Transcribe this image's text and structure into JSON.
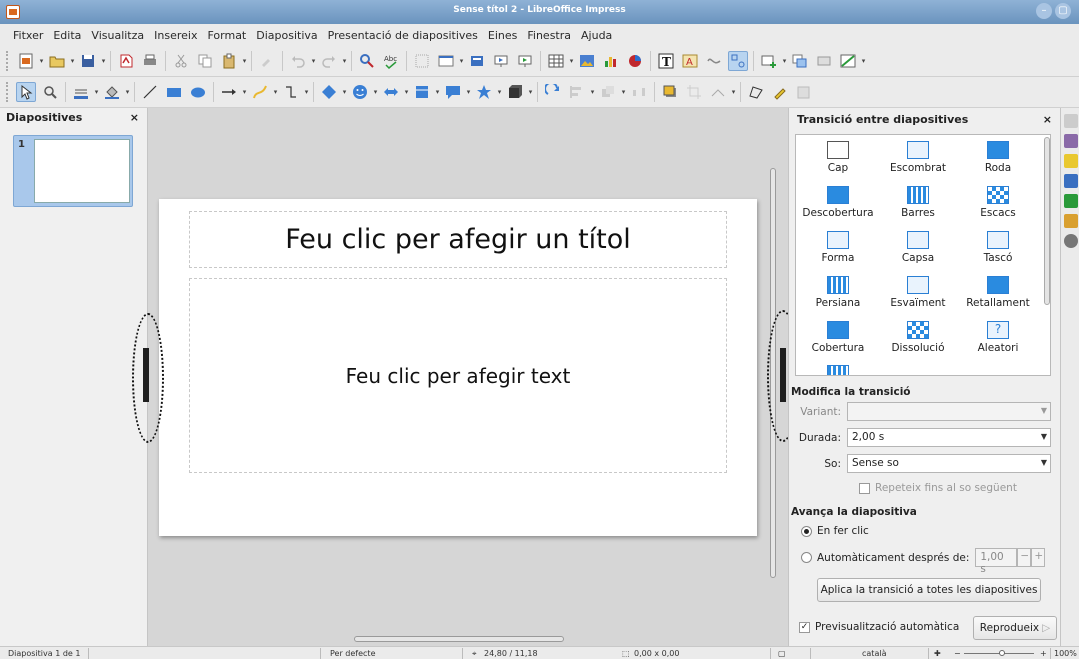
{
  "window": {
    "title": "Sense títol 2 - LibreOffice Impress"
  },
  "menu": [
    "Fitxer",
    "Edita",
    "Visualitza",
    "Insereix",
    "Format",
    "Diapositiva",
    "Presentació de diapositives",
    "Eines",
    "Finestra",
    "Ajuda"
  ],
  "slides_pane": {
    "title": "Diapositives",
    "close": "×",
    "slide_number": "1"
  },
  "slide": {
    "title_placeholder": "Feu clic per afegir un títol",
    "body_placeholder": "Feu clic per afegir text"
  },
  "transition_panel": {
    "title": "Transició entre diapositives",
    "close": "×",
    "transitions": [
      "Cap",
      "Escombrat",
      "Roda",
      "Descobertura",
      "Barres",
      "Escacs",
      "Forma",
      "Capsa",
      "Tascó",
      "Persiana",
      "Esvaïment",
      "Retallament",
      "Cobertura",
      "Dissolució",
      "Aleatori"
    ],
    "modify_section": "Modifica la transició",
    "variant_label": "Variant:",
    "variant_value": "",
    "duration_label": "Durada:",
    "duration_value": "2,00 s",
    "sound_label": "So:",
    "sound_value": "Sense so",
    "repeat_label": "Repeteix fins al so següent",
    "advance_section": "Avança la diapositiva",
    "on_click_label": "En fer clic",
    "auto_label": "Automàticament després de:",
    "auto_value": "1,00 s",
    "minus": "−",
    "plus": "+",
    "apply_all": "Aplica la transició a totes les diapositives",
    "auto_preview": "Previsualització automàtica",
    "play": "Reprodueix"
  },
  "status": {
    "slide_info": "Diapositiva 1 de 1",
    "master": "Per defecte",
    "position": "24,80 / 11,18",
    "size": "0,00 x 0,00",
    "language": "català",
    "zoom": "100%"
  }
}
